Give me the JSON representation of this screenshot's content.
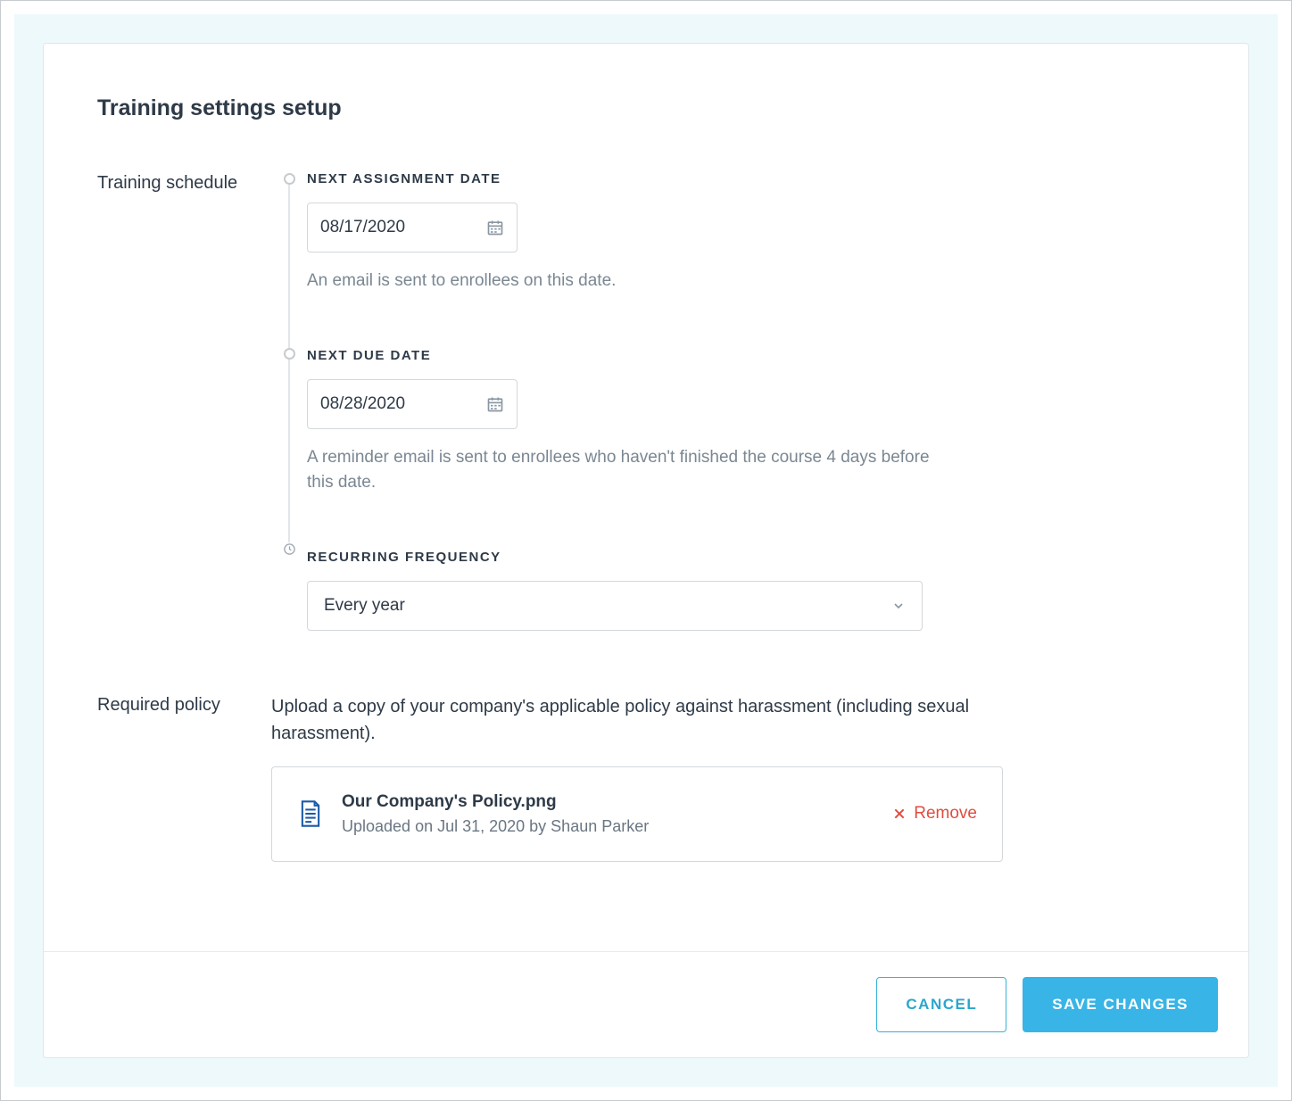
{
  "page": {
    "title": "Training settings setup"
  },
  "schedule": {
    "section_label": "Training schedule",
    "assignment": {
      "label": "NEXT ASSIGNMENT DATE",
      "value": "08/17/2020",
      "helper": "An email is sent to enrollees on this date."
    },
    "due": {
      "label": "NEXT DUE DATE",
      "value": "08/28/2020",
      "helper": "A reminder email is sent to enrollees who haven't finished the course 4 days before this date."
    },
    "frequency": {
      "label": "RECURRING FREQUENCY",
      "selected": "Every year"
    }
  },
  "policy": {
    "section_label": "Required policy",
    "description": "Upload a copy of your company's applicable policy against harassment (including sexual harassment).",
    "file": {
      "name": "Our Company's Policy.png",
      "meta": "Uploaded on Jul 31, 2020 by Shaun Parker",
      "remove_label": "Remove"
    }
  },
  "footer": {
    "cancel": "CANCEL",
    "save": "SAVE CHANGES"
  }
}
